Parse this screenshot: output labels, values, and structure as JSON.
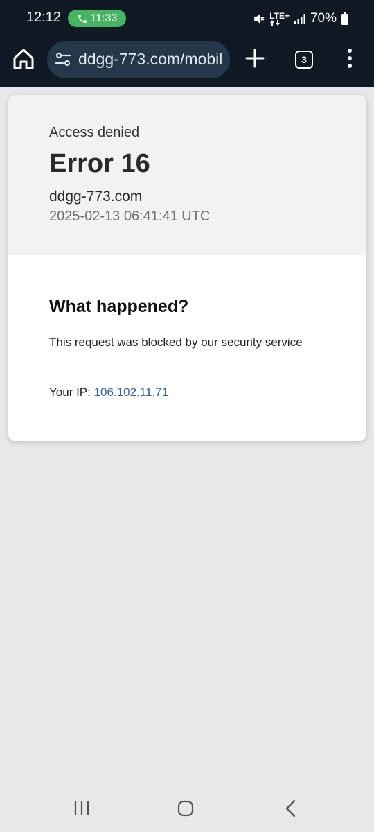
{
  "status_bar": {
    "time": "12:12",
    "call_time": "11:33",
    "network": "LTE+",
    "battery": "70%"
  },
  "browser": {
    "url": "ddgg-773.com/mobil",
    "tab_count": "3"
  },
  "page": {
    "access_denied": "Access denied",
    "error_title": "Error 16",
    "domain": "ddgg-773.com",
    "timestamp": "2025-02-13 06:41:41 UTC",
    "what_happened": "What happened?",
    "blocked_text": "This request was blocked by our security service",
    "ip_label": "Your IP:",
    "ip_value": "106.102.11.71"
  },
  "colors": {
    "chrome_bg": "#111a24",
    "url_bar_bg": "#25384a",
    "call_pill": "#45b463",
    "link": "#2e63a8",
    "page_bg": "#e8e8e8"
  },
  "icons": {
    "phone": "phone-icon",
    "mute": "vibrate-mute-icon",
    "signal": "signal-icon",
    "battery": "battery-icon",
    "home": "home-icon",
    "site_settings": "site-settings-icon",
    "new_tab": "plus-icon",
    "menu": "more-vert-icon",
    "nav_recent": "recent-apps-icon",
    "nav_home": "nav-home-icon",
    "nav_back": "back-icon"
  }
}
